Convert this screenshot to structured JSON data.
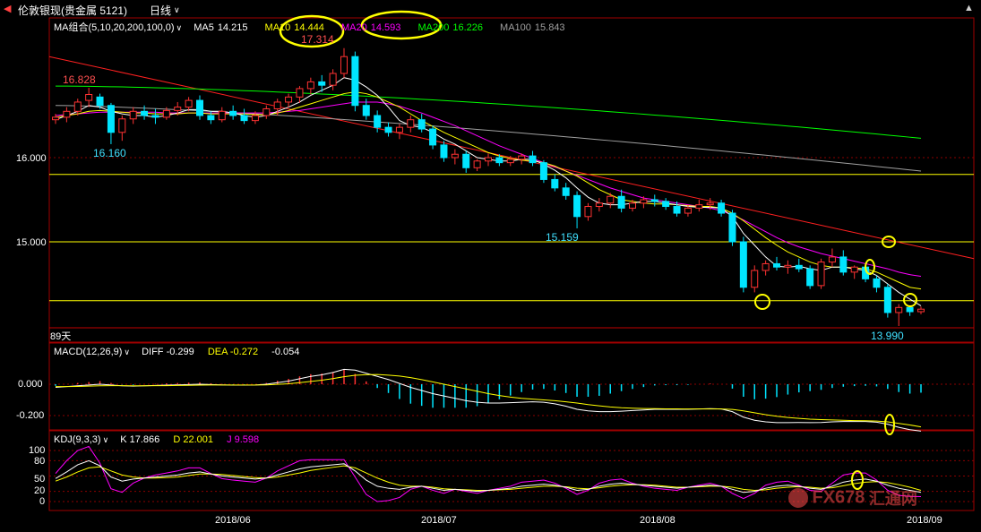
{
  "window": {
    "title": "伦敦银现(贵金属 5121)",
    "period": "日线"
  },
  "colors": {
    "up": "#ff3232",
    "down": "#00e5ff",
    "ma5": "#ffffff",
    "ma10": "#ffff00",
    "ma20": "#ff00ff",
    "ma200": "#00ff00",
    "ma100": "#a0a0a0",
    "trend": "#ff2020",
    "hline": "#ffff00",
    "grid": "#8b0000"
  },
  "main_panel": {
    "indicator": "MA组合(5,10,20,200,100,0)",
    "ma_values": [
      {
        "label": "MA5",
        "value": "14.215",
        "color": "#ffffff"
      },
      {
        "label": "MA10",
        "value": "14.444",
        "color": "#ffff00"
      },
      {
        "label": "MA20",
        "value": "14.593",
        "color": "#ff00ff"
      },
      {
        "label": "MA200",
        "value": "16.226",
        "color": "#00ff00"
      },
      {
        "label": "MA100",
        "value": "15.843",
        "color": "#a0a0a0"
      }
    ],
    "y_ticks": [
      "16.000",
      "15.000"
    ],
    "annotations": {
      "high": "17.314",
      "left_high": "16.828",
      "left_low": "16.160",
      "mid_low": "15.159",
      "last_low": "13.990"
    },
    "days_label": "89天"
  },
  "macd_panel": {
    "indicator": "MACD(12,26,9)",
    "diff": "DIFF -0.299",
    "dea": "DEA -0.272",
    "macd": "-0.054",
    "y_ticks": [
      "0.000",
      "-0.200"
    ]
  },
  "kdj_panel": {
    "indicator": "KDJ(9,3,3)",
    "k": "K 17.866",
    "d": "D 22.001",
    "j": "J 9.598",
    "y_ticks": [
      "100",
      "80",
      "50",
      "20",
      "0"
    ]
  },
  "x_labels": [
    "2018/06",
    "2018/07",
    "2018/08",
    "2018/09"
  ],
  "watermark": {
    "text": "FX678",
    "cn": "汇通网"
  },
  "chart_data": {
    "type": "candlestick",
    "x_start": "2018/05/21",
    "ylim": [
      13.95,
      17.4
    ],
    "horizontal_lines": [
      15.8,
      15.0,
      14.3
    ],
    "candles": [
      [
        16.45,
        16.52,
        16.4,
        16.48
      ],
      [
        16.48,
        16.6,
        16.42,
        16.55
      ],
      [
        16.55,
        16.7,
        16.5,
        16.66
      ],
      [
        16.68,
        16.83,
        16.6,
        16.75
      ],
      [
        16.72,
        16.76,
        16.58,
        16.62
      ],
      [
        16.62,
        16.65,
        16.16,
        16.3
      ],
      [
        16.3,
        16.5,
        16.2,
        16.46
      ],
      [
        16.46,
        16.6,
        16.4,
        16.55
      ],
      [
        16.55,
        16.62,
        16.45,
        16.5
      ],
      [
        16.5,
        16.58,
        16.4,
        16.48
      ],
      [
        16.48,
        16.6,
        16.45,
        16.56
      ],
      [
        16.56,
        16.66,
        16.5,
        16.6
      ],
      [
        16.6,
        16.72,
        16.55,
        16.68
      ],
      [
        16.68,
        16.74,
        16.45,
        16.5
      ],
      [
        16.5,
        16.55,
        16.4,
        16.45
      ],
      [
        16.45,
        16.6,
        16.42,
        16.55
      ],
      [
        16.55,
        16.62,
        16.45,
        16.5
      ],
      [
        16.5,
        16.58,
        16.4,
        16.44
      ],
      [
        16.44,
        16.55,
        16.4,
        16.5
      ],
      [
        16.5,
        16.62,
        16.46,
        16.58
      ],
      [
        16.58,
        16.7,
        16.5,
        16.66
      ],
      [
        16.66,
        16.76,
        16.6,
        16.72
      ],
      [
        16.72,
        16.85,
        16.65,
        16.82
      ],
      [
        16.82,
        16.95,
        16.75,
        16.9
      ],
      [
        16.9,
        16.98,
        16.78,
        16.86
      ],
      [
        16.86,
        17.05,
        16.8,
        17.0
      ],
      [
        17.0,
        17.3,
        16.95,
        17.2
      ],
      [
        17.2,
        17.26,
        16.55,
        16.62
      ],
      [
        16.62,
        16.7,
        16.45,
        16.5
      ],
      [
        16.5,
        16.56,
        16.3,
        16.36
      ],
      [
        16.36,
        16.42,
        16.25,
        16.3
      ],
      [
        16.3,
        16.4,
        16.22,
        16.36
      ],
      [
        16.36,
        16.5,
        16.3,
        16.45
      ],
      [
        16.45,
        16.52,
        16.3,
        16.34
      ],
      [
        16.34,
        16.38,
        16.1,
        16.15
      ],
      [
        16.15,
        16.2,
        15.95,
        16.0
      ],
      [
        16.0,
        16.1,
        15.92,
        16.04
      ],
      [
        16.04,
        16.08,
        15.82,
        15.88
      ],
      [
        15.88,
        15.98,
        15.84,
        15.96
      ],
      [
        15.96,
        16.05,
        15.9,
        16.0
      ],
      [
        16.0,
        16.04,
        15.9,
        15.94
      ],
      [
        15.94,
        16.02,
        15.9,
        15.98
      ],
      [
        15.98,
        16.05,
        15.92,
        16.02
      ],
      [
        16.02,
        16.08,
        15.9,
        15.94
      ],
      [
        15.94,
        15.97,
        15.7,
        15.74
      ],
      [
        15.74,
        15.8,
        15.6,
        15.64
      ],
      [
        15.64,
        15.7,
        15.5,
        15.55
      ],
      [
        15.55,
        15.6,
        15.16,
        15.3
      ],
      [
        15.3,
        15.46,
        15.25,
        15.42
      ],
      [
        15.42,
        15.52,
        15.36,
        15.46
      ],
      [
        15.46,
        15.58,
        15.4,
        15.54
      ],
      [
        15.54,
        15.62,
        15.35,
        15.4
      ],
      [
        15.4,
        15.5,
        15.36,
        15.46
      ],
      [
        15.46,
        15.54,
        15.4,
        15.5
      ],
      [
        15.5,
        15.56,
        15.42,
        15.48
      ],
      [
        15.48,
        15.52,
        15.38,
        15.42
      ],
      [
        15.42,
        15.48,
        15.3,
        15.34
      ],
      [
        15.34,
        15.44,
        15.3,
        15.4
      ],
      [
        15.4,
        15.5,
        15.36,
        15.44
      ],
      [
        15.44,
        15.52,
        15.38,
        15.46
      ],
      [
        15.46,
        15.5,
        15.3,
        15.34
      ],
      [
        15.34,
        15.38,
        14.95,
        15.0
      ],
      [
        15.0,
        15.06,
        14.4,
        14.46
      ],
      [
        14.46,
        14.72,
        14.4,
        14.66
      ],
      [
        14.66,
        14.78,
        14.6,
        14.74
      ],
      [
        14.74,
        14.82,
        14.66,
        14.7
      ],
      [
        14.7,
        14.78,
        14.62,
        14.72
      ],
      [
        14.72,
        14.8,
        14.64,
        14.68
      ],
      [
        14.68,
        14.72,
        14.44,
        14.48
      ],
      [
        14.48,
        14.8,
        14.44,
        14.76
      ],
      [
        14.76,
        14.92,
        14.7,
        14.82
      ],
      [
        14.82,
        14.9,
        14.6,
        14.64
      ],
      [
        14.64,
        14.72,
        14.56,
        14.7
      ],
      [
        14.7,
        14.74,
        14.52,
        14.56
      ],
      [
        14.56,
        14.6,
        14.4,
        14.46
      ],
      [
        14.46,
        14.5,
        14.1,
        14.16
      ],
      [
        14.16,
        14.26,
        14.0,
        14.22
      ],
      [
        14.22,
        14.24,
        14.12,
        14.17
      ],
      [
        14.17,
        14.23,
        14.14,
        14.2
      ]
    ],
    "ma5": [
      16.45,
      16.5,
      16.55,
      16.62,
      16.6,
      16.55,
      16.52,
      16.5,
      16.5,
      16.48,
      16.5,
      16.53,
      16.57,
      16.57,
      16.55,
      16.55,
      16.53,
      16.5,
      16.48,
      16.5,
      16.55,
      16.6,
      16.66,
      16.74,
      16.8,
      16.86,
      16.95,
      16.92,
      16.84,
      16.74,
      16.6,
      16.44,
      16.38,
      16.36,
      16.3,
      16.22,
      16.16,
      16.08,
      16.0,
      15.98,
      15.96,
      15.96,
      15.98,
      15.98,
      15.92,
      15.85,
      15.76,
      15.64,
      15.53,
      15.46,
      15.44,
      15.44,
      15.46,
      15.48,
      15.48,
      15.46,
      15.44,
      15.42,
      15.41,
      15.41,
      15.4,
      15.3,
      15.1,
      14.96,
      14.82,
      14.71,
      14.7,
      14.71,
      14.68,
      14.66,
      14.7,
      14.7,
      14.68,
      14.66,
      14.6,
      14.5,
      14.4,
      14.32,
      14.24
    ],
    "ma10": [
      16.48,
      16.5,
      16.52,
      16.55,
      16.56,
      16.55,
      16.54,
      16.53,
      16.53,
      16.52,
      16.52,
      16.52,
      16.53,
      16.53,
      16.52,
      16.52,
      16.52,
      16.52,
      16.51,
      16.51,
      16.53,
      16.56,
      16.6,
      16.64,
      16.68,
      16.72,
      16.76,
      16.78,
      16.76,
      16.72,
      16.66,
      16.6,
      16.52,
      16.44,
      16.37,
      16.3,
      16.24,
      16.18,
      16.12,
      16.06,
      16.02,
      15.99,
      15.97,
      15.96,
      15.94,
      15.9,
      15.84,
      15.78,
      15.7,
      15.62,
      15.56,
      15.5,
      15.48,
      15.46,
      15.45,
      15.45,
      15.44,
      15.43,
      15.42,
      15.42,
      15.4,
      15.34,
      15.25,
      15.15,
      15.05,
      14.96,
      14.88,
      14.82,
      14.76,
      14.72,
      14.7,
      14.7,
      14.69,
      14.68,
      14.64,
      14.58,
      14.52,
      14.46,
      14.44
    ],
    "ma20": [
      16.5,
      16.51,
      16.52,
      16.53,
      16.54,
      16.54,
      16.54,
      16.54,
      16.54,
      16.54,
      16.53,
      16.53,
      16.53,
      16.53,
      16.53,
      16.53,
      16.53,
      16.53,
      16.53,
      16.53,
      16.54,
      16.55,
      16.56,
      16.58,
      16.6,
      16.62,
      16.64,
      16.66,
      16.66,
      16.66,
      16.64,
      16.61,
      16.57,
      16.53,
      16.48,
      16.43,
      16.38,
      16.32,
      16.26,
      16.2,
      16.14,
      16.09,
      16.04,
      15.99,
      15.94,
      15.89,
      15.84,
      15.79,
      15.74,
      15.69,
      15.64,
      15.6,
      15.56,
      15.52,
      15.5,
      15.48,
      15.46,
      15.44,
      15.42,
      15.4,
      15.37,
      15.32,
      15.26,
      15.19,
      15.12,
      15.05,
      14.99,
      14.94,
      14.9,
      14.86,
      14.83,
      14.8,
      14.77,
      14.74,
      14.71,
      14.68,
      14.64,
      14.61,
      14.59
    ],
    "ma200_endpoints": [
      16.85,
      16.23
    ],
    "ma100_endpoints": [
      16.62,
      15.84
    ],
    "trendline_endpoints": [
      17.2,
      14.8
    ],
    "macd": {
      "ylim": [
        -0.32,
        0.14
      ],
      "diff": [
        -0.02,
        -0.015,
        -0.01,
        -0.005,
        0.0,
        -0.005,
        -0.01,
        -0.012,
        -0.01,
        -0.008,
        -0.006,
        -0.004,
        -0.002,
        0.0,
        -0.002,
        -0.004,
        -0.006,
        -0.006,
        -0.005,
        0.0,
        0.01,
        0.02,
        0.035,
        0.05,
        0.06,
        0.075,
        0.095,
        0.09,
        0.07,
        0.05,
        0.03,
        0.005,
        -0.02,
        -0.04,
        -0.06,
        -0.075,
        -0.09,
        -0.105,
        -0.115,
        -0.12,
        -0.12,
        -0.118,
        -0.115,
        -0.112,
        -0.115,
        -0.125,
        -0.14,
        -0.16,
        -0.17,
        -0.175,
        -0.175,
        -0.172,
        -0.168,
        -0.164,
        -0.16,
        -0.16,
        -0.16,
        -0.16,
        -0.158,
        -0.156,
        -0.158,
        -0.175,
        -0.21,
        -0.23,
        -0.24,
        -0.245,
        -0.245,
        -0.244,
        -0.245,
        -0.244,
        -0.24,
        -0.238,
        -0.238,
        -0.238,
        -0.242,
        -0.255,
        -0.275,
        -0.29,
        -0.299
      ],
      "dea": [
        -0.015,
        -0.015,
        -0.014,
        -0.012,
        -0.01,
        -0.009,
        -0.009,
        -0.01,
        -0.01,
        -0.009,
        -0.009,
        -0.008,
        -0.007,
        -0.006,
        -0.005,
        -0.005,
        -0.005,
        -0.005,
        -0.005,
        -0.004,
        -0.001,
        0.003,
        0.01,
        0.018,
        0.026,
        0.036,
        0.048,
        0.057,
        0.061,
        0.062,
        0.058,
        0.052,
        0.042,
        0.029,
        0.015,
        0.0,
        -0.015,
        -0.03,
        -0.045,
        -0.06,
        -0.072,
        -0.082,
        -0.09,
        -0.095,
        -0.1,
        -0.105,
        -0.112,
        -0.12,
        -0.13,
        -0.138,
        -0.145,
        -0.15,
        -0.153,
        -0.155,
        -0.156,
        -0.157,
        -0.157,
        -0.158,
        -0.158,
        -0.158,
        -0.158,
        -0.161,
        -0.17,
        -0.182,
        -0.194,
        -0.204,
        -0.212,
        -0.218,
        -0.223,
        -0.226,
        -0.228,
        -0.23,
        -0.232,
        -0.233,
        -0.235,
        -0.24,
        -0.25,
        -0.26,
        -0.272
      ]
    },
    "kdj": {
      "ylim": [
        -5,
        110
      ],
      "k": [
        45,
        58,
        72,
        80,
        70,
        48,
        40,
        44,
        46,
        48,
        50,
        52,
        56,
        58,
        54,
        50,
        48,
        46,
        44,
        46,
        52,
        58,
        64,
        68,
        70,
        72,
        74,
        60,
        42,
        30,
        26,
        24,
        28,
        30,
        26,
        22,
        24,
        22,
        20,
        22,
        24,
        26,
        30,
        32,
        34,
        32,
        28,
        22,
        24,
        30,
        34,
        36,
        34,
        32,
        30,
        28,
        26,
        28,
        30,
        32,
        30,
        24,
        18,
        20,
        26,
        30,
        32,
        30,
        26,
        24,
        30,
        38,
        42,
        44,
        40,
        32,
        26,
        22,
        18
      ],
      "d": [
        40,
        48,
        58,
        66,
        68,
        60,
        52,
        48,
        46,
        46,
        47,
        48,
        51,
        54,
        54,
        53,
        51,
        49,
        47,
        46,
        48,
        52,
        56,
        61,
        64,
        67,
        70,
        66,
        56,
        46,
        38,
        32,
        30,
        30,
        28,
        25,
        24,
        23,
        22,
        22,
        23,
        24,
        26,
        28,
        30,
        30,
        29,
        26,
        25,
        27,
        30,
        32,
        33,
        33,
        32,
        30,
        28,
        28,
        29,
        30,
        30,
        28,
        24,
        22,
        23,
        26,
        28,
        29,
        28,
        26,
        27,
        31,
        35,
        38,
        39,
        37,
        33,
        28,
        22
      ],
      "j": [
        55,
        80,
        100,
        108,
        75,
        25,
        18,
        36,
        46,
        52,
        56,
        60,
        66,
        66,
        55,
        45,
        42,
        40,
        38,
        46,
        60,
        70,
        80,
        82,
        82,
        82,
        82,
        48,
        14,
        0,
        2,
        8,
        24,
        30,
        22,
        16,
        24,
        20,
        16,
        22,
        26,
        30,
        38,
        40,
        42,
        36,
        26,
        14,
        22,
        36,
        42,
        44,
        36,
        30,
        26,
        24,
        22,
        28,
        32,
        36,
        30,
        16,
        6,
        16,
        32,
        38,
        40,
        32,
        22,
        20,
        36,
        52,
        56,
        56,
        42,
        22,
        12,
        10,
        9.6
      ]
    }
  }
}
